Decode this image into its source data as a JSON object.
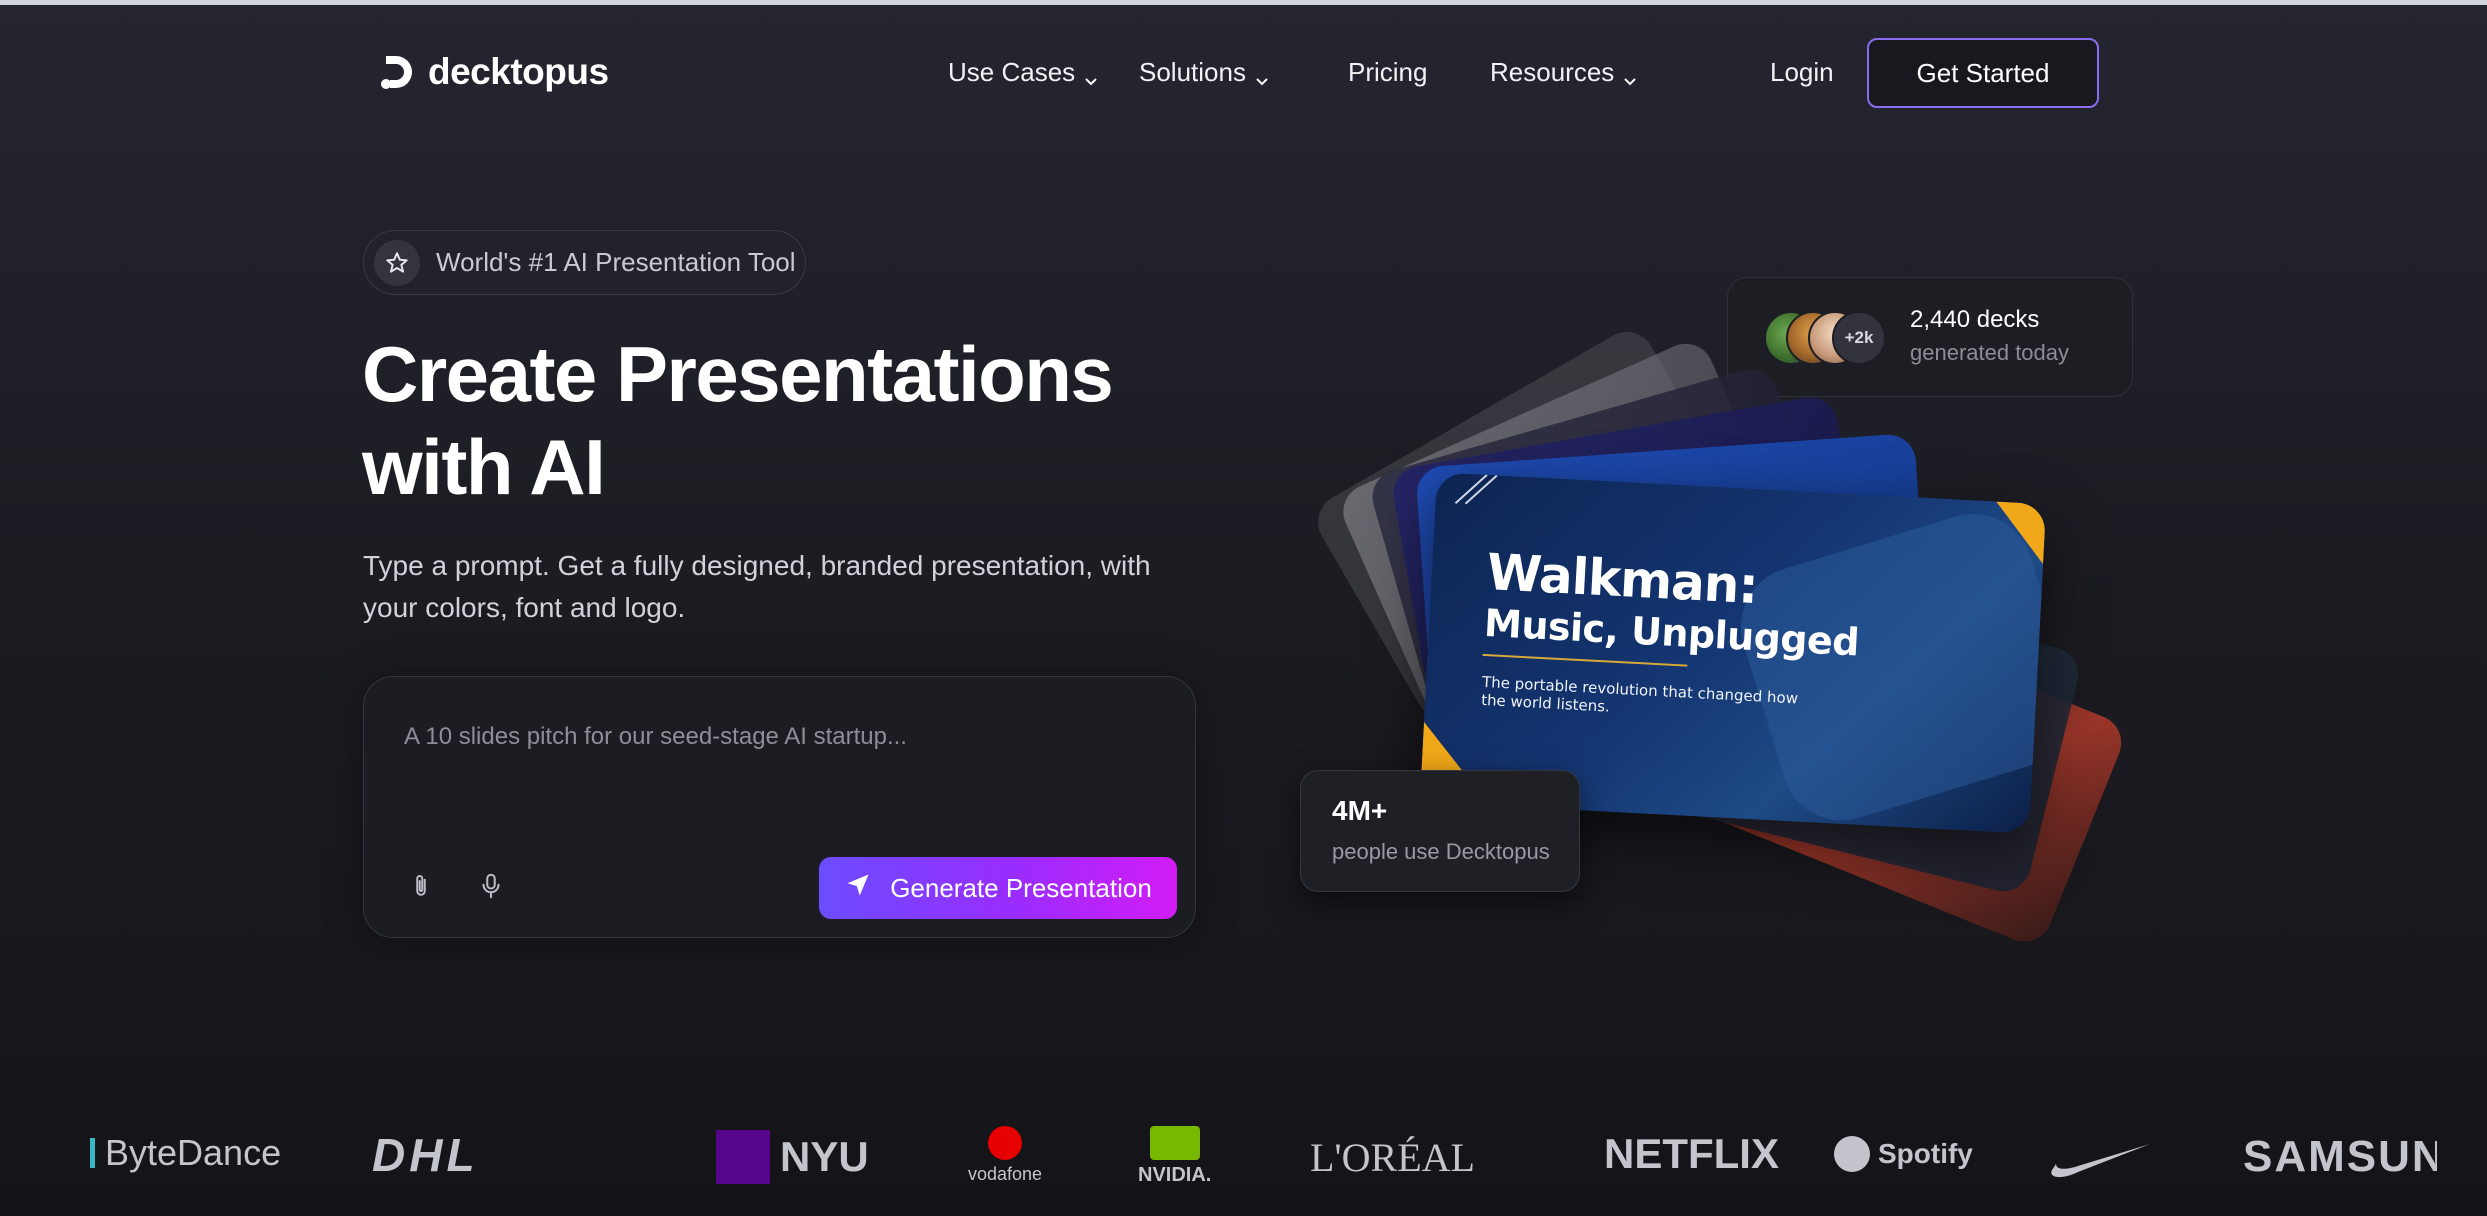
{
  "nav": {
    "brand": "decktopus",
    "items": [
      {
        "label": "Use Cases",
        "has_dropdown": true
      },
      {
        "label": "Solutions",
        "has_dropdown": true
      },
      {
        "label": "Pricing",
        "has_dropdown": false
      },
      {
        "label": "Resources",
        "has_dropdown": true
      }
    ],
    "login": "Login",
    "get_started": "Get Started"
  },
  "hero": {
    "badge": "World's #1 AI Presentation Tool",
    "title_line1": "Create Presentations",
    "title_line2": "with AI",
    "subtitle": "Type a prompt. Get a fully designed, branded presentation, with your colors, font and logo.",
    "prompt_placeholder": "A 10 slides pitch for our seed-stage AI startup...",
    "generate_button": "Generate Presentation"
  },
  "stats": {
    "decks_count": "2,440 decks",
    "decks_label": "generated today",
    "avatars_more": "+2k",
    "users_count": "4M+",
    "users_label": "people use Decktopus"
  },
  "preview_slide": {
    "title": "Walkman:",
    "subtitle": "Music, Unplugged",
    "caption": "The portable revolution that changed how the world listens."
  },
  "logos": {
    "bytedance": "ByteDance",
    "dhl": "DHL",
    "nyu": "NYU",
    "vodafone": "vodafone",
    "nvidia": "NVIDIA.",
    "loreal": "L'ORÉAL",
    "netflix": "NETFLIX",
    "spotify": "Spotify",
    "samsung": "SAMSUN"
  },
  "colors": {
    "accent_gradient_start": "#6b4cff",
    "accent_gradient_end": "#d21cf5",
    "button_border": "#8b6cf0",
    "background": "#1c1c23"
  }
}
